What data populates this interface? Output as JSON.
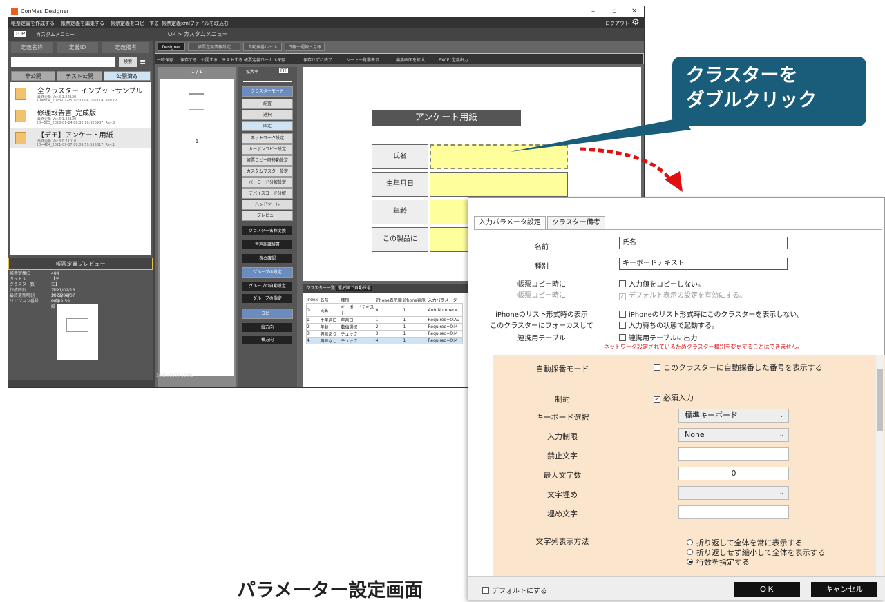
{
  "app": {
    "title": "ConMas Designer",
    "menu": [
      "帳票定義を作成する",
      "帳票定義を編集する",
      "帳票定義をコピーする",
      "帳票定義xmlファイルを取込む"
    ],
    "logout": "ログアウト"
  },
  "left": {
    "top_label": "TOP",
    "title": "カスタムメニュー",
    "cols": [
      "定義名称",
      "定義ID",
      "定義備考"
    ],
    "search": "検索",
    "tabs": [
      "非公開",
      "テスト公開",
      "公開済み"
    ],
    "items": [
      {
        "name": "全クラスター インプットサンプル",
        "s1": "最終更新 Ver.8.1.22120",
        "s2": "ID=504_2023-01-25 10:03:04.102114, Rev.12"
      },
      {
        "name": "修理報告書_完成版",
        "s1": "最終更新 Ver.8.1.22120",
        "s2": "ID=505_2023-01-24 08:32:10.920987, Rev.3"
      },
      {
        "name": "【デモ】アンケート用紙",
        "s1": "最終更新 Ver.8.0.21010",
        "s2": "ID=484_2021-09-07 08:09:59.555817, Rev.1"
      }
    ],
    "preview_title": "帳票定義プレビュー",
    "meta": [
      [
        "帳票定義ID",
        "484"
      ],
      [
        "タイトル",
        "【デモ】アンケート用紙"
      ],
      [
        "クラスター数",
        "5"
      ],
      [
        "作成時刻",
        "2021/02/18 15:52:44"
      ],
      [
        "最終更新時刻",
        "2021/09/07 08:09:59"
      ],
      [
        "リビジョン番号",
        "1"
      ]
    ]
  },
  "center": {
    "crumb": "TOP  >  カスタムメニュー",
    "tabs": [
      "Designer",
      "帳票定義情報設定",
      "自動採番ルール",
      "日報一週報・月報"
    ],
    "toolbar": [
      "一時保存",
      "保存する",
      "公開する",
      "テストする",
      "帳票定義ローカル保存",
      "保存せずに終了",
      "シート一覧非表示",
      "編集画面を拡大",
      "EXCEL定義出力"
    ],
    "page_counter": "1 / 1",
    "page_number": "1",
    "zoom": "拡大率",
    "fit": "FIT",
    "tools": [
      "クラスターモード",
      "配置",
      "選択",
      "固定",
      "ネットワーク設定",
      "カーボンコピー設定",
      "帳票コピー時移動設定",
      "カスタムマスター設定",
      "バーコード分解設定",
      "デバイスコード分解",
      "ハンドツール",
      "プレビュー",
      "クラスター名称変換",
      "音声認識辞書",
      "表の確認",
      "グループの設定",
      "グループの自動設定",
      "グループの指定",
      "コピー",
      "縦方向",
      "横方向"
    ],
    "status": "1060x1500  100%"
  },
  "form": {
    "title": "アンケート用紙",
    "labels": [
      "氏名",
      "生年月日",
      "年齢",
      "この製品に"
    ]
  },
  "grid": {
    "title": "クラスター一覧",
    "btn": "選択順で自動採番",
    "headers": [
      "Index",
      "名前",
      "種別",
      "iPhone表示順",
      "iPhone表示",
      "入力パラメータ"
    ],
    "rows": [
      [
        "0",
        "氏名",
        "キーボードテキスト",
        "0",
        "1",
        "AutoNumber="
      ],
      [
        "1",
        "生年月日",
        "年月日",
        "1",
        "1",
        "Required=0;Au"
      ],
      [
        "2",
        "年齢",
        "数値選択",
        "2",
        "1",
        "Required=0;M"
      ],
      [
        "3",
        "興味あり",
        "チェック",
        "3",
        "1",
        "Required=0;M"
      ],
      [
        "4",
        "興味なし",
        "チェック",
        "4",
        "1",
        "Required=0;M"
      ]
    ]
  },
  "callout": {
    "line1": "クラスターを",
    "line2": "ダブルクリック"
  },
  "dialog": {
    "tabs": [
      "入力パラメータ設定",
      "クラスター備考"
    ],
    "name_label": "名前",
    "name_value": "氏名",
    "type_label": "種別",
    "type_value": "キーボードテキスト",
    "copy_label": "帳票コピー時に",
    "copy_opt": "入力値をコピーしない。",
    "copy_label2": "帳票コピー時に",
    "copy_opt2": "デフォルト表示の設定を有効にする。",
    "iphone_label": "iPhoneのリスト形式時の表示",
    "iphone_opt": "iPhoneのリスト形式時にこのクラスターを表示しない。",
    "focus_label": "このクラスターにフォーカスして",
    "focus_opt": "入力待ちの状態で起動する。",
    "link_label": "連携用テーブル",
    "link_opt": "連携用テーブルに出力",
    "warning": "ネットワーク設定されているためクラスター種別を変更することはできません。",
    "auto_label": "自動採番モード",
    "auto_opt": "このクラスターに自動採番した番号を表示する",
    "constraint_label": "制約",
    "constraint_opt": "必須入力",
    "kb_label": "キーボード選択",
    "kb_value": "標準キーボード",
    "limit_label": "入力制限",
    "limit_value": "None",
    "forbid_label": "禁止文字",
    "forbid_value": "",
    "max_label": "最大文字数",
    "max_value": "0",
    "fill_label": "文字埋め",
    "fill_value": "",
    "fillchar_label": "埋め文字",
    "fillchar_value": "",
    "disp_label": "文字列表示方法",
    "radios": [
      "折り返して全体を常に表示する",
      "折り返しせず縮小して全体を表示する",
      "行数を指定する"
    ],
    "default_opt": "デフォルトにする",
    "ok": "ＯＫ",
    "cancel": "キャンセル"
  },
  "caption": "パラメーター設定画面",
  "colors": {
    "callout": "#1a5d7a",
    "dialog_bg": "#fbe5cd",
    "arrow": "#e01010",
    "highlight": "#fefe9a"
  }
}
